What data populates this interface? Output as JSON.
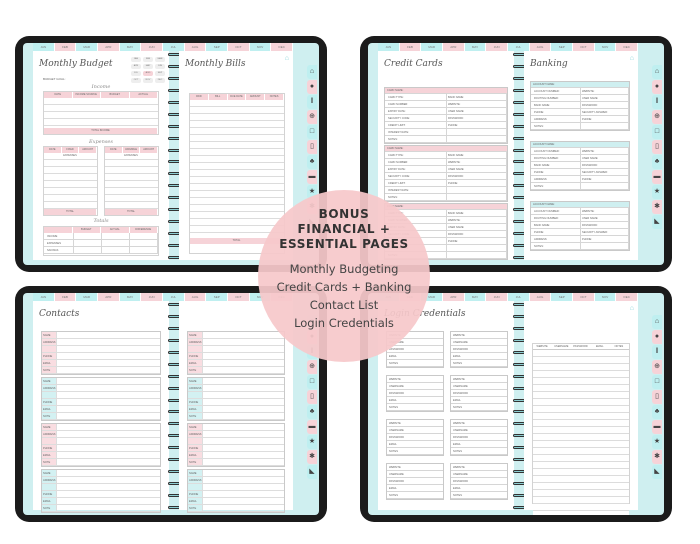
{
  "months": [
    "JAN",
    "FEB",
    "MAR",
    "APR",
    "MAY",
    "JUN",
    "JUL",
    "AUG",
    "SEP",
    "OCT",
    "NOV",
    "DEC"
  ],
  "side_tabs": [
    {
      "icon": "home-icon",
      "glyph": "⌂"
    },
    {
      "icon": "piggy-bank-icon",
      "glyph": "●"
    },
    {
      "icon": "contacts-icon",
      "glyph": "ǁ"
    },
    {
      "icon": "login-icon",
      "glyph": "⊕"
    },
    {
      "icon": "screen-icon",
      "glyph": "□"
    },
    {
      "icon": "document-icon",
      "glyph": "▯"
    },
    {
      "icon": "leaf-icon",
      "glyph": "♣"
    },
    {
      "icon": "briefcase-icon",
      "glyph": "▬"
    },
    {
      "icon": "star-icon",
      "glyph": "★"
    },
    {
      "icon": "runner-icon",
      "glyph": "✱"
    },
    {
      "icon": "chart-icon",
      "glyph": "◣"
    }
  ],
  "budget": {
    "title": "Monthly Budget",
    "budget_goal_label": "BUDGET GOAL:",
    "month_grid": [
      "JAN",
      "FEB",
      "MAR",
      "APR",
      "MAY",
      "JUN",
      "JUL",
      "AUG",
      "SEP",
      "OCT",
      "NOV",
      "DEC"
    ],
    "income_heading": "Income",
    "income_cols": [
      "DATE",
      "INCOME SOURCE",
      "BUDGET",
      "ACTUAL"
    ],
    "total_income": "TOTAL INCOME",
    "expenses_heading": "Expenses",
    "fixed_cols": [
      "DATE",
      "FIXED EXPENSES",
      "AMOUNT"
    ],
    "variable_cols": [
      "DATE",
      "VARIABLE EXPENSES",
      "AMOUNT"
    ],
    "total": "TOTAL",
    "totals_heading": "Totals",
    "totals_cols": [
      "BUDGET",
      "ACTUAL",
      "DIFFERENCE"
    ],
    "totals_rows": [
      "INCOME",
      "EXPENSES",
      "SAVINGS"
    ]
  },
  "bills": {
    "title": "Monthly Bills",
    "cols": [
      "PAID",
      "BILL",
      "DUE DATE",
      "AMOUNT",
      "NOTES"
    ],
    "total": "TOTAL"
  },
  "credit_cards": {
    "title": "Credit Cards",
    "card_name": "CARD NAME:",
    "rows": [
      [
        "CARD TYPE:",
        "BANK NAME:"
      ],
      [
        "CARD NUMBER:",
        "WEBSITE:"
      ],
      [
        "EXPIRY DATE:",
        "USER NAME:"
      ],
      [
        "SECURITY CODE:",
        "PASSWORD:"
      ],
      [
        "CREDIT LIMIT:",
        "PHONE:"
      ],
      [
        "INTEREST RATE:",
        ""
      ],
      [
        "NOTES:",
        ""
      ]
    ],
    "credit": "CREDIT",
    "debit": "DEBIT"
  },
  "banking": {
    "title": "Banking",
    "account_name": "ACCOUNT NAME:",
    "rows": [
      [
        "ACCOUNT NUMBER:",
        "WEBSITE:"
      ],
      [
        "ROUTING NUMBER:",
        "USER NAME:"
      ],
      [
        "BANK NAME:",
        "PASSWORD:"
      ],
      [
        "PHONE:",
        "SECURITY ANSWER:"
      ],
      [
        "ADDRESS:",
        "PHONE:"
      ],
      [
        "NOTES:",
        ""
      ]
    ]
  },
  "contacts": {
    "title": "Contacts",
    "fields": [
      "NAME",
      "ADDRESS",
      "",
      "PHONE",
      "EMAIL",
      "NOTE"
    ]
  },
  "credentials": {
    "title": "Login Credentials",
    "fields": [
      "WEBSITE",
      "USERNAME",
      "PASSWORD",
      "EMAIL",
      "NOTES"
    ],
    "table_cols": [
      "WEBSITE",
      "USERNAME",
      "PASSWORD",
      "EMAIL",
      "NOTES"
    ]
  },
  "promo": {
    "title_lines": [
      "BONUS",
      "FINANCIAL +",
      "ESSENTIAL PAGES"
    ],
    "items": [
      "Monthly Budgeting",
      "Credit Cards + Banking",
      "Contact List",
      "Login Credentials"
    ]
  }
}
